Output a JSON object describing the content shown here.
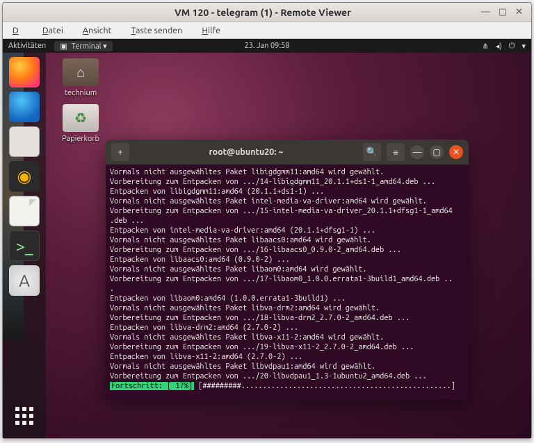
{
  "remote_viewer": {
    "title": "VM 120 - telegram (1) - Remote Viewer",
    "window_controls": {
      "min": "—",
      "max": "▢",
      "close": "✕"
    },
    "menubar": {
      "file": "Datei",
      "view": "Ansicht",
      "send_key": "Taste senden",
      "help": "Hilfe"
    }
  },
  "gnome": {
    "activities": "Aktivitäten",
    "app_chip": "Terminal ▾",
    "clock": "23. Jan  09:58",
    "status_icons": [
      "⋔",
      "◂)",
      "⏻",
      "▾"
    ]
  },
  "dock": {
    "items": [
      {
        "name": "firefox",
        "glyph": ""
      },
      {
        "name": "thunderbird",
        "glyph": ""
      },
      {
        "name": "files",
        "glyph": ""
      },
      {
        "name": "rhythmbox",
        "glyph": "◉"
      },
      {
        "name": "libreoffice",
        "glyph": ""
      },
      {
        "name": "terminal",
        "glyph": ">_"
      },
      {
        "name": "software",
        "glyph": "A"
      }
    ]
  },
  "desktop_icons": {
    "folder": {
      "label": "technium",
      "glyph": "⌂"
    },
    "trash": {
      "label": "Papierkorb",
      "glyph": "♻"
    }
  },
  "terminal": {
    "titlebar": {
      "add_tab": "+",
      "title": "root@ubuntu20: ~",
      "search": "🔍",
      "menu": "≡",
      "min": "—",
      "max": "▢",
      "close": "✕"
    },
    "lines": [
      "Vormals nicht ausgewähltes Paket libigdgmm11:amd64 wird gewählt.",
      "Vorbereitung zum Entpacken von .../14-libigdgmm11_20.1.1+ds1-1_amd64.deb ...",
      "Entpacken von libigdgmm11:amd64 (20.1.1+ds1-1) ...",
      "Vormals nicht ausgewähltes Paket intel-media-va-driver:amd64 wird gewählt.",
      "Vorbereitung zum Entpacken von .../15-intel-media-va-driver_20.1.1+dfsg1-1_amd64",
      ".deb ...",
      "Entpacken von intel-media-va-driver:amd64 (20.1.1+dfsg1-1) ...",
      "Vormals nicht ausgewähltes Paket libaacs0:amd64 wird gewählt.",
      "Vorbereitung zum Entpacken von .../16-libaacs0_0.9.0-2_amd64.deb ...",
      "Entpacken von libaacs0:amd64 (0.9.0-2) ...",
      "Vormals nicht ausgewähltes Paket libaom0:amd64 wird gewählt.",
      "Vorbereitung zum Entpacken von .../17-libaom0_1.0.0.errata1-3build1_amd64.deb ..",
      ".",
      "Entpacken von libaom0:amd64 (1.0.0.errata1-3build1) ...",
      "Vormals nicht ausgewähltes Paket libva-drm2:amd64 wird gewählt.",
      "Vorbereitung zum Entpacken von .../18-libva-drm2_2.7.0-2_amd64.deb ...",
      "Entpacken von libva-drm2:amd64 (2.7.0-2) ...",
      "Vormals nicht ausgewähltes Paket libva-x11-2:amd64 wird gewählt.",
      "Vorbereitung zum Entpacken von .../19-libva-x11-2_2.7.0-2_amd64.deb ...",
      "Entpacken von libva-x11-2:amd64 (2.7.0-2) ...",
      "Vormals nicht ausgewähltes Paket libvdpau1:amd64 wird gewählt.",
      "Vorbereitung zum Entpacken von .../20-libvdpau1_1.3-1ubuntu2_amd64.deb ..."
    ],
    "progress": {
      "label": "Fortschritt: [ 17%]",
      "bar": " [#########.................................................]"
    }
  }
}
